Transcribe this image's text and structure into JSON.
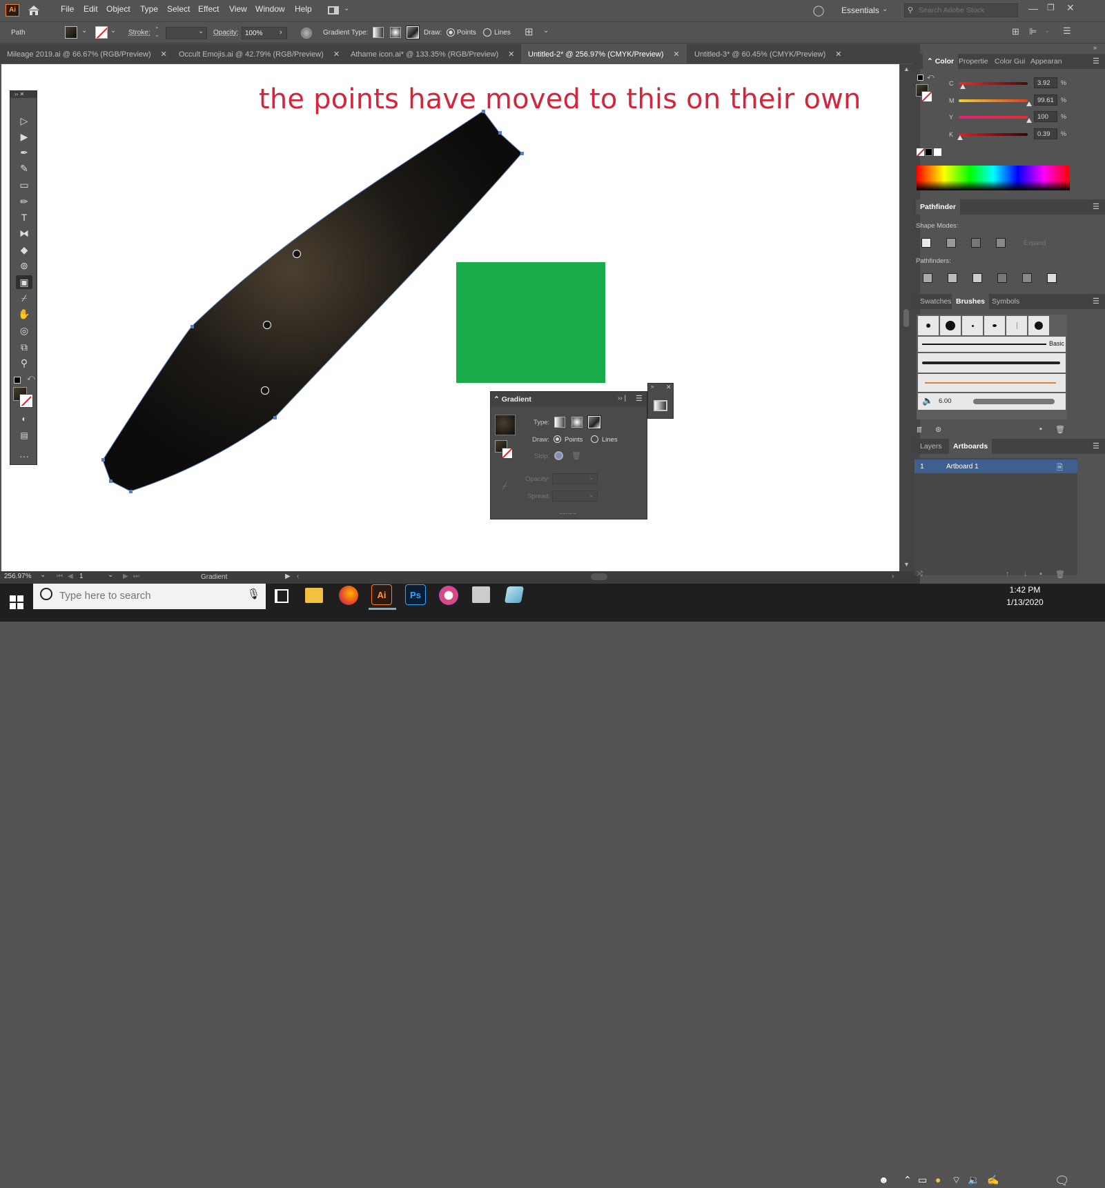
{
  "app": {
    "logo": "Ai",
    "menus": [
      "File",
      "Edit",
      "Object",
      "Type",
      "Select",
      "Effect",
      "View",
      "Window",
      "Help"
    ],
    "workspace": "Essentials",
    "search_placeholder": "Search Adobe Stock",
    "colors": {
      "accent": "#b5472a",
      "canvas": "#ffffff",
      "chrome": "#535353",
      "dark": "#424242",
      "selection": "#3f5f8f"
    }
  },
  "control_bar": {
    "selection_type": "Path",
    "stroke_label": "Stroke:",
    "opacity_label": "Opacity:",
    "opacity_value": "100%",
    "gradient_type_label": "Gradient Type:",
    "draw_label": "Draw:",
    "points_label": "Points",
    "lines_label": "Lines"
  },
  "tabs": [
    {
      "label": "Mileage 2019.ai @ 66.67% (RGB/Preview)",
      "close": "✕",
      "active": false
    },
    {
      "label": "Occult Emojis.ai @ 42.79% (RGB/Preview)",
      "close": "✕",
      "active": false
    },
    {
      "label": "Athame icon.ai* @ 133.35% (RGB/Preview)",
      "close": "✕",
      "active": false
    },
    {
      "label": "Untitled-2* @ 256.97% (CMYK/Preview)",
      "close": "✕",
      "active": true
    },
    {
      "label": "Untitled-3* @ 60.45% (CMYK/Preview)",
      "close": "✕",
      "active": false
    }
  ],
  "canvas": {
    "annotation": "the points have moved to this on their own",
    "annotation_color": "#d4263a",
    "square_color": "#1aab4a",
    "shape_color_dark": "#0d0c0b",
    "shape_color_light": "#4b4030"
  },
  "status": {
    "zoom": "256.97%",
    "artboard": "1",
    "tool_name": "Gradient"
  },
  "color_panel": {
    "tabs": [
      "Color",
      "Propertie",
      "Color Gui",
      "Appearan"
    ],
    "channels": [
      {
        "label": "C",
        "value": "3.92",
        "unit": "%",
        "color": "#e03030",
        "level": 0.0392
      },
      {
        "label": "M",
        "value": "99.61",
        "unit": "%",
        "color": "#f0c020",
        "level": 0.9961
      },
      {
        "label": "Y",
        "value": "100",
        "unit": "%",
        "color": "#e0207a",
        "level": 1.0
      },
      {
        "label": "K",
        "value": "0.39",
        "unit": "%",
        "color": "#b02020",
        "level": 0.0039
      }
    ]
  },
  "pathfinder": {
    "title": "Pathfinder",
    "shape_modes_label": "Shape Modes:",
    "expand_label": "Expand",
    "pathfinders_label": "Pathfinders:"
  },
  "brushes_panel": {
    "tabs": [
      "Swatches",
      "Brushes",
      "Symbols"
    ],
    "basic_label": "Basic",
    "size_value": "6.00"
  },
  "layers_panel": {
    "tabs": [
      "Layers",
      "Artboards"
    ],
    "rows": [
      {
        "index": "1",
        "name": "Artboard 1"
      }
    ]
  },
  "gradient_panel": {
    "title": "Gradient",
    "type_label": "Type:",
    "draw_label": "Draw:",
    "points_label": "Points",
    "lines_label": "Lines",
    "stop_label": "Stop:",
    "opacity_label": "Opacity:",
    "spread_label": "Spread:"
  },
  "taskbar": {
    "search_placeholder": "Type here to search",
    "time": "1:42 PM",
    "date": "1/13/2020",
    "apps": [
      "Task View",
      "File Explorer",
      "Firefox",
      "Illustrator",
      "Photoshop",
      "iTunes",
      "Printer",
      "Notes"
    ]
  }
}
